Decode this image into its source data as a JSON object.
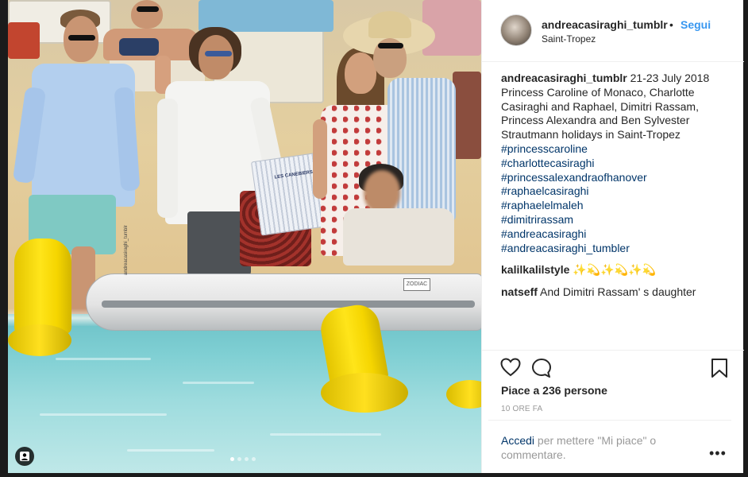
{
  "post": {
    "username": "andreacasiraghi_tumblr",
    "follow_label": "Segui",
    "location": "Saint-Tropez",
    "caption_text": "21-23 July 2018 Princess Caroline of Monaco, Charlotte Casiraghi and Raphael, Dimitri Rassam, Princess Alexandra and Ben Sylvester Strautmann holidays in Saint-Tropez",
    "hashtags": [
      "#princesscaroline",
      "#charlottecasiraghi",
      "#princessalexandraofhanover",
      "#raphaelcasiraghi",
      "#raphaelelmaleh",
      "#dimitrirassam",
      "#andreacasiraghi",
      "#andreacasiraghi_tumbler"
    ],
    "comments": [
      {
        "username": "kalilkalilstyle",
        "text": "✨💫✨💫✨💫"
      },
      {
        "username": "natseff",
        "text": "And Dimitri Rassam' s daughter"
      }
    ],
    "likes_prefix": "Piace a ",
    "likes_count": "236",
    "likes_suffix": " persone",
    "time_ago": "10 ORE FA",
    "login_link": "Accedi",
    "login_text": " per mettere \"Mi piace\" o commentare.",
    "bag_text": "LES CANEBIERS",
    "boat_brand": "ZODIAC",
    "watermark": "andreacasiraghi_tumblr"
  },
  "photo": {
    "carousel_total": 4,
    "carousel_active": 1
  },
  "icons": {
    "like": "heart-outline-icon",
    "comment": "speech-bubble-icon",
    "save": "bookmark-icon",
    "more": "ellipsis-icon",
    "tag": "user-tag-icon"
  },
  "colors": {
    "link": "#003569",
    "follow": "#3897f0",
    "muted": "#999999"
  }
}
